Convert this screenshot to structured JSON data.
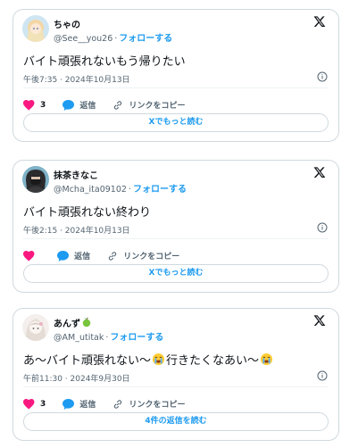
{
  "colors": {
    "accent": "#1d9bf0",
    "heart": "#f91880",
    "text": "#0f1419",
    "muted": "#536471",
    "border": "#cfd9de"
  },
  "cards": [
    {
      "display_name": "ちゃの",
      "handle": "@See__you26",
      "separator": "·",
      "follow_label": "フォローする",
      "text": "バイト頑張れないもう帰りたい",
      "time": "午後7:35 · 2024年10月13日",
      "like_count": "3",
      "reply_label": "返信",
      "copy_link_label": "リンクをコピー",
      "read_more_label": "Xでもっと読む"
    },
    {
      "display_name": "抹茶きなこ",
      "handle": "@Mcha_ita09102",
      "separator": "·",
      "follow_label": "フォローする",
      "text": "バイト頑張れない終わり",
      "time": "午後2:15 · 2024年10月13日",
      "like_count": "",
      "reply_label": "返信",
      "copy_link_label": "リンクをコピー",
      "read_more_label": "Xでもっと読む"
    },
    {
      "display_name": "あんず",
      "handle": "@AM_utitak",
      "separator": "·",
      "follow_label": "フォローする",
      "text_part1": "あ〜バイト頑張れない〜",
      "text_part2": "行きたくなあい〜",
      "time": "午前11:30 · 2024年9月30日",
      "like_count": "3",
      "reply_label": "返信",
      "copy_link_label": "リンクをコピー",
      "read_more_label": "4件の返信を読む"
    }
  ]
}
